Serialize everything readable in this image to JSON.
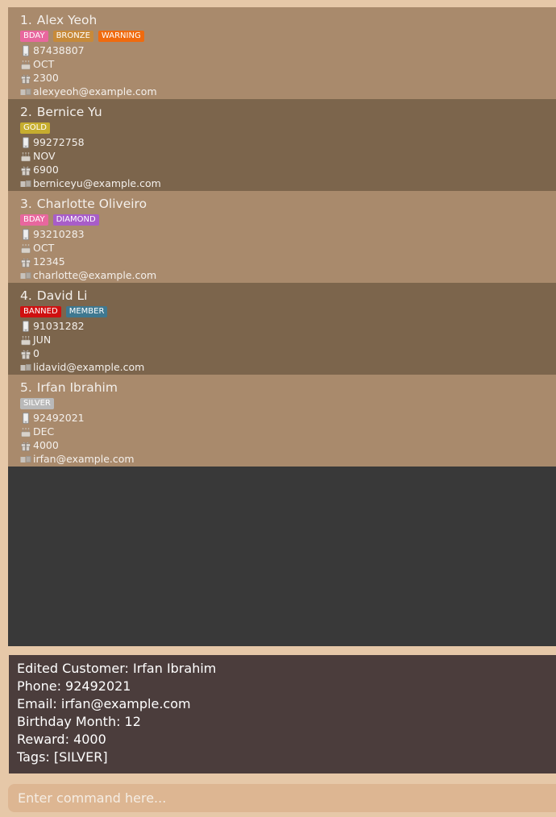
{
  "colors": {
    "BDAY": "#e8679e",
    "BRONZE": "#c78a3a",
    "WARNING": "#f06a0e",
    "GOLD": "#c6ad2f",
    "DIAMOND": "#a85dc8",
    "BANNED": "#cf1010",
    "MEMBER": "#3f7890",
    "SILVER": "#b9b9b9"
  },
  "customers": [
    {
      "index": "1.",
      "name": "Alex Yeoh",
      "tags": [
        "BDAY",
        "BRONZE",
        "WARNING"
      ],
      "phone": "87438807",
      "birthday": "OCT",
      "reward": "2300",
      "email": "alexyeoh@example.com"
    },
    {
      "index": "2.",
      "name": "Bernice Yu",
      "tags": [
        "GOLD"
      ],
      "phone": "99272758",
      "birthday": "NOV",
      "reward": "6900",
      "email": "berniceyu@example.com"
    },
    {
      "index": "3.",
      "name": "Charlotte Oliveiro",
      "tags": [
        "BDAY",
        "DIAMOND"
      ],
      "phone": "93210283",
      "birthday": "OCT",
      "reward": "12345",
      "email": "charlotte@example.com"
    },
    {
      "index": "4.",
      "name": "David Li",
      "tags": [
        "BANNED",
        "MEMBER"
      ],
      "phone": "91031282",
      "birthday": "JUN",
      "reward": "0",
      "email": "lidavid@example.com"
    },
    {
      "index": "5.",
      "name": "Irfan Ibrahim",
      "tags": [
        "SILVER"
      ],
      "phone": "92492021",
      "birthday": "DEC",
      "reward": "4000",
      "email": "irfan@example.com"
    }
  ],
  "result": {
    "lines": [
      "Edited Customer: Irfan Ibrahim",
      "Phone: 92492021",
      "Email: irfan@example.com",
      "Birthday Month: 12",
      "Reward: 4000",
      "Tags: [SILVER]"
    ]
  },
  "command": {
    "placeholder": "Enter command here..."
  }
}
